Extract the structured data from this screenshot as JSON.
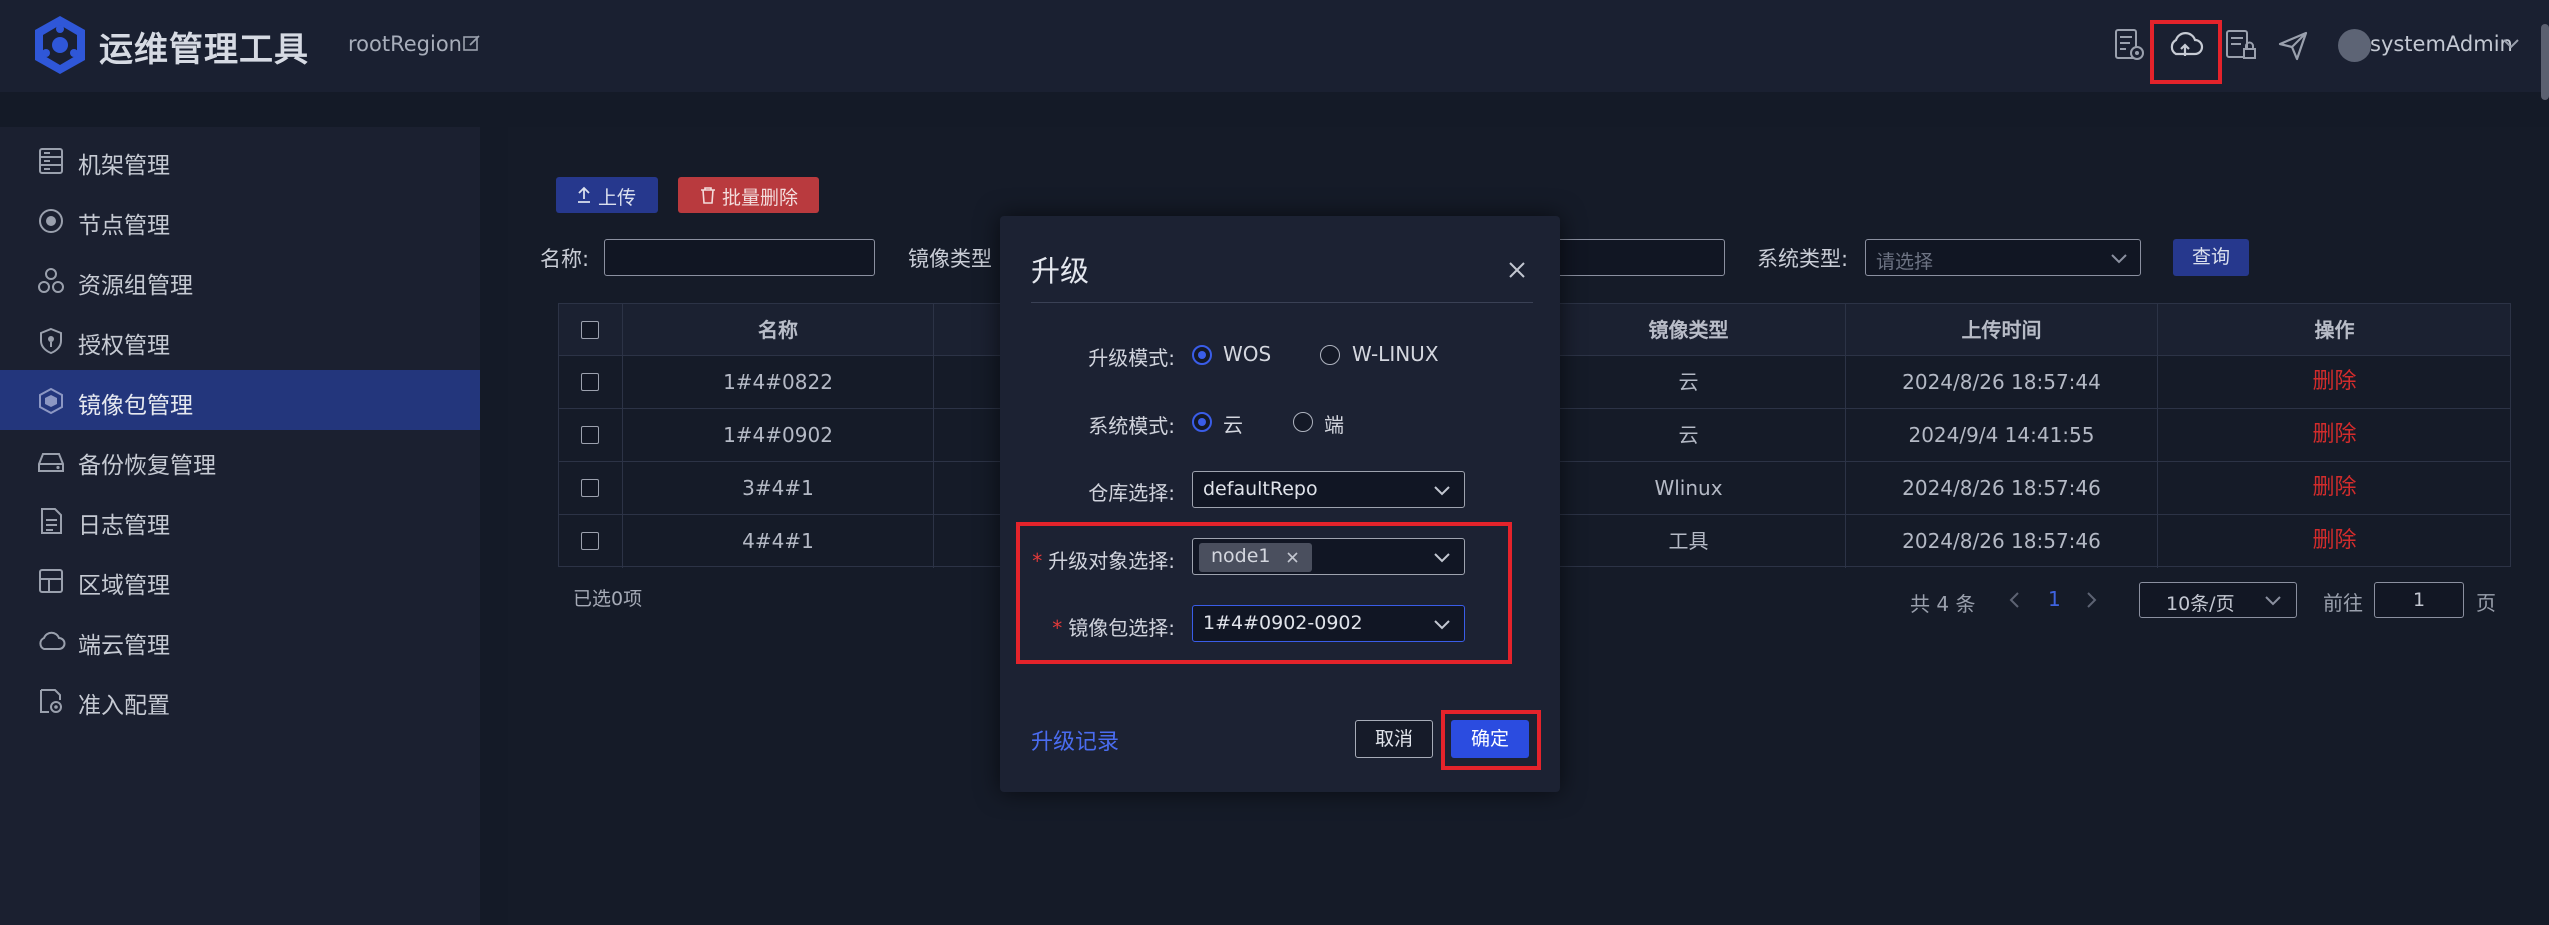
{
  "app": {
    "title": "运维管理工具",
    "region": "rootRegion"
  },
  "header": {
    "icons": [
      "document-settings-icon",
      "cloud-upload-icon",
      "list-lock-icon",
      "send-icon"
    ],
    "username": "systemAdmin"
  },
  "sidebar": {
    "items": [
      {
        "label": "机架管理",
        "icon": "server-rack-icon",
        "active": false
      },
      {
        "label": "节点管理",
        "icon": "node-icon",
        "active": false
      },
      {
        "label": "资源组管理",
        "icon": "cubes-icon",
        "active": false
      },
      {
        "label": "授权管理",
        "icon": "shield-key-icon",
        "active": false
      },
      {
        "label": "镜像包管理",
        "icon": "package-icon",
        "active": true
      },
      {
        "label": "备份恢复管理",
        "icon": "backup-drive-icon",
        "active": false
      },
      {
        "label": "日志管理",
        "icon": "log-file-icon",
        "active": false
      },
      {
        "label": "区域管理",
        "icon": "region-icon",
        "active": false
      },
      {
        "label": "端云管理",
        "icon": "cloud-icon",
        "active": false
      },
      {
        "label": "准入配置",
        "icon": "gear-doc-icon",
        "active": false
      }
    ]
  },
  "toolbar": {
    "upload_label": "上传",
    "batch_delete_label": "批量删除"
  },
  "filters": {
    "name_label": "名称:",
    "image_type_label": "镜像类型",
    "system_type_label": "系统类型:",
    "system_type_placeholder": "请选择",
    "query_label": "查询"
  },
  "table": {
    "columns": [
      "名称",
      "镜像类型",
      "上传时间",
      "操作"
    ],
    "rows": [
      {
        "name": "1#4#0822",
        "image_type": "云",
        "upload_time": "2024/8/26 18:57:44",
        "action": "删除"
      },
      {
        "name": "1#4#0902",
        "image_type": "云",
        "upload_time": "2024/9/4 14:41:55",
        "action": "删除"
      },
      {
        "name": "3#4#1",
        "image_type": "Wlinux",
        "upload_time": "2024/8/26 18:57:46",
        "action": "删除"
      },
      {
        "name": "4#4#1",
        "image_type": "工具",
        "upload_time": "2024/8/26 18:57:46",
        "action": "删除"
      }
    ]
  },
  "footer": {
    "selected": "已选0项",
    "total": "共 4 条",
    "current_page": "1",
    "page_size": "10条/页",
    "goto_label": "前往",
    "goto_value": "1",
    "goto_suffix": "页"
  },
  "modal": {
    "title": "升级",
    "upgrade_mode_label": "升级模式:",
    "upgrade_mode_options": [
      "WOS",
      "W-LINUX"
    ],
    "upgrade_mode_selected": "WOS",
    "system_mode_label": "系统模式:",
    "system_mode_options": [
      "云",
      "端"
    ],
    "system_mode_selected": "云",
    "repo_label": "仓库选择:",
    "repo_value": "defaultRepo",
    "target_label": "升级对象选择:",
    "target_tags": [
      "node1"
    ],
    "image_label": "镜像包选择:",
    "image_value": "1#4#0902-0902",
    "history_link": "升级记录",
    "cancel_label": "取消",
    "ok_label": "确定"
  },
  "colors": {
    "accent": "#2b4ce0",
    "active_nav": "#23367c",
    "danger": "#d22c2c",
    "highlight_box": "#e4232b"
  }
}
